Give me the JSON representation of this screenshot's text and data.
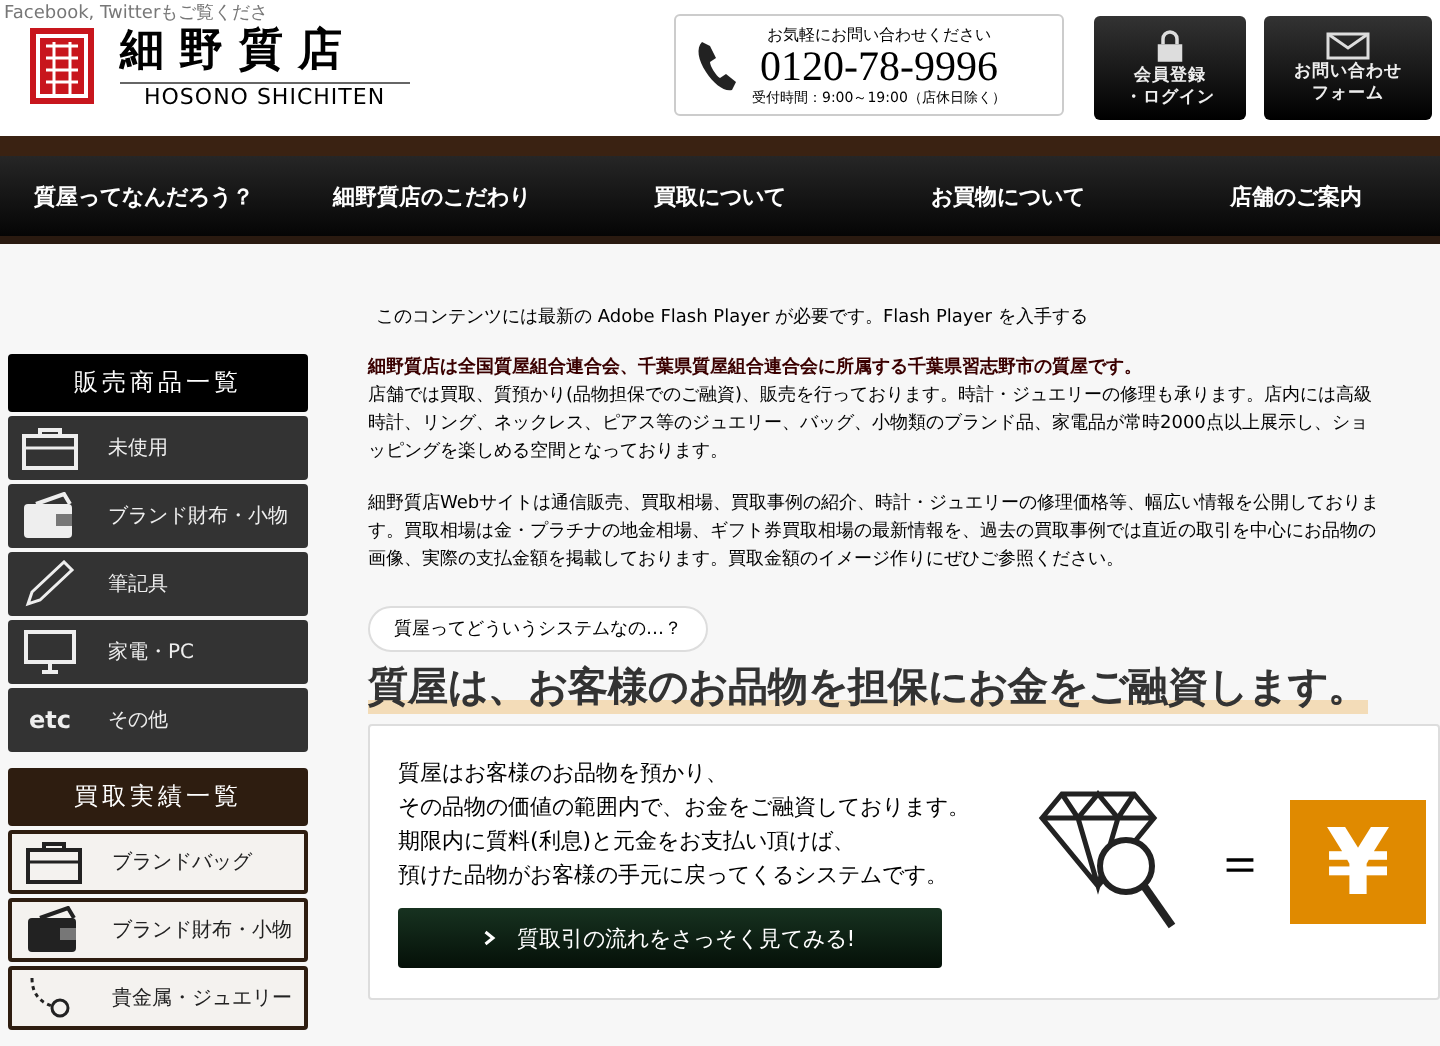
{
  "header": {
    "social_note": "Facebook, Twitterもご覧くださ",
    "logo_title": "細 野 質 店",
    "logo_subtitle": "HOSONO SHICHITEN",
    "phone": {
      "caption": "お気軽にお問い合わせください",
      "number": "0120-78-9996",
      "hours": "受付時間：9:00～19:00（店休日除く）"
    },
    "buttons": [
      {
        "kind": "lock",
        "label_lines": [
          "会員登録",
          "・ログイン"
        ]
      },
      {
        "kind": "mail",
        "label_lines": [
          "お問い合わせ",
          "フォーム"
        ]
      }
    ]
  },
  "nav": [
    "質屋ってなんだろう？",
    "細野質店のこだわり",
    "買取について",
    "お買物について",
    "店舗のご案内"
  ],
  "sidebar": {
    "sections": [
      {
        "title": "販売商品一覧",
        "kind": "dark",
        "items": [
          {
            "label": "未使用",
            "kind": "bag"
          },
          {
            "label": "ブランド財布・小物",
            "kind": "wallet"
          },
          {
            "label": "筆記具",
            "kind": "pen"
          },
          {
            "label": "家電・PC",
            "kind": "monitor"
          },
          {
            "label": "その他",
            "kind": "text",
            "icon_text": "etc"
          }
        ]
      },
      {
        "title": "買取実績一覧",
        "kind": "light",
        "items": [
          {
            "label": "ブランドバッグ",
            "kind": "bag"
          },
          {
            "label": "ブランド財布・小物",
            "kind": "wallet"
          },
          {
            "label": "貴金属・ジュエリー",
            "kind": "necklace"
          }
        ]
      }
    ]
  },
  "flash_notice": "このコンテンツには最新の Adobe Flash Player が必要です。Flash Player を入手する",
  "intro": {
    "lead": "細野質店は全国質屋組合連合会、千葉県質屋組合連合会に所属する千葉県習志野市の質屋です。",
    "paragraphs": [
      "店舗では買取、質預かり(品物担保でのご融資)、販売を行っております。時計・ジュエリーの修理も承ります。店内には高級時計、リング、ネックレス、ピアス等のジュエリー、バッグ、小物類のブランド品、家電品が常時2000点以上展示し、ショッピングを楽しめる空間となっております。",
      "細野質店Webサイトは通信販売、買取相場、買取事例の紹介、時計・ジュエリーの修理価格等、幅広い情報を公開しております。買取相場は金・プラチナの地金相場、ギフト券買取相場の最新情報を、過去の買取事例では直近の取引を中心にお品物の画像、実際の支払金額を掲載しております。買取金額のイメージ作りにぜひご参照ください。"
    ]
  },
  "system": {
    "bubble": "質屋ってどういうシステムなの…？",
    "headline": "質屋は、お客様のお品物を担保にお金をご融資します。",
    "lines": [
      "質屋はお客様のお品物を預かり、",
      "その品物の価値の範囲内で、お金をご融資しております。",
      "期限内に質料(利息)と元金をお支払い頂けば、",
      "預けた品物がお客様の手元に戻ってくるシステムです。"
    ],
    "button": "質取引の流れをさっそく見てみる!",
    "equals": "＝",
    "yen": "¥"
  }
}
